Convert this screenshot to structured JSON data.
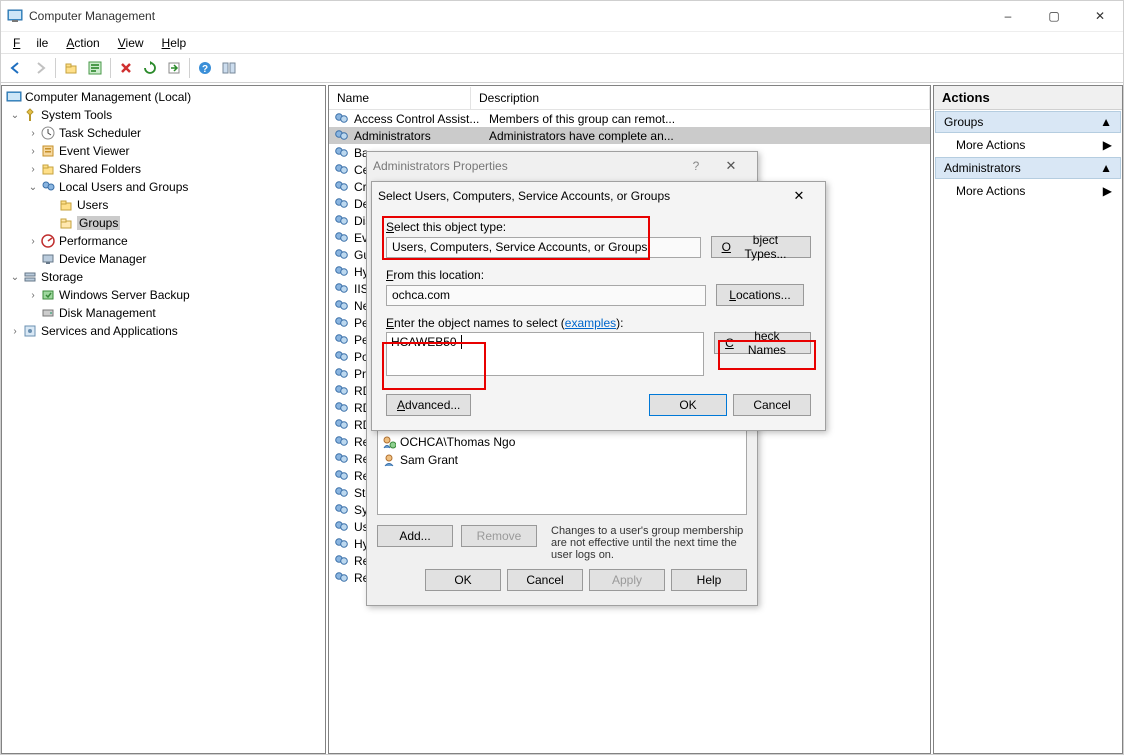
{
  "window": {
    "title": "Computer Management",
    "btn_min": "–",
    "btn_max": "▢",
    "btn_close": "✕"
  },
  "menu": {
    "file": "File",
    "action": "Action",
    "view": "View",
    "help": "Help"
  },
  "tree": {
    "root": "Computer Management (Local)",
    "systools": "System Tools",
    "task": "Task Scheduler",
    "event": "Event Viewer",
    "shared": "Shared Folders",
    "lug": "Local Users and Groups",
    "users": "Users",
    "groups": "Groups",
    "perf": "Performance",
    "devmgr": "Device Manager",
    "storage": "Storage",
    "wsb": "Windows Server Backup",
    "disk": "Disk Management",
    "svc": "Services and Applications"
  },
  "list": {
    "col_name": "Name",
    "col_desc": "Description",
    "rows": [
      {
        "n": "Access Control Assist...",
        "d": "Members of this group can remot..."
      },
      {
        "n": "Administrators",
        "d": "Administrators have complete an...",
        "sel": true
      },
      {
        "n": "Ba",
        "d": ""
      },
      {
        "n": "Ce",
        "d": ""
      },
      {
        "n": "Cr",
        "d": ""
      },
      {
        "n": "De",
        "d": ""
      },
      {
        "n": "Dis",
        "d": ""
      },
      {
        "n": "Ev",
        "d": ""
      },
      {
        "n": "Gu",
        "d": ""
      },
      {
        "n": "Hy",
        "d": ""
      },
      {
        "n": "IIS",
        "d": ""
      },
      {
        "n": "Ne",
        "d": ""
      },
      {
        "n": "Pe",
        "d": ""
      },
      {
        "n": "Pe",
        "d": ""
      },
      {
        "n": "Po",
        "d": ""
      },
      {
        "n": "Pri",
        "d": ""
      },
      {
        "n": "RD",
        "d": ""
      },
      {
        "n": "RD",
        "d": ""
      },
      {
        "n": "RD",
        "d": ""
      },
      {
        "n": "Re",
        "d": ""
      },
      {
        "n": "Re",
        "d": ""
      },
      {
        "n": "Re",
        "d": ""
      },
      {
        "n": "Sto",
        "d": ""
      },
      {
        "n": "Sy",
        "d": ""
      },
      {
        "n": "Us",
        "d": ""
      },
      {
        "n": "Hy",
        "d": ""
      },
      {
        "n": "Remote Control Oper...",
        "d": ""
      },
      {
        "n": "Remote Control View ...",
        "d": ""
      }
    ]
  },
  "actions": {
    "header": "Actions",
    "sec1": "Groups",
    "more1": "More Actions",
    "sec2": "Administrators",
    "more2": "More Actions"
  },
  "prop": {
    "title": "Administrators Properties",
    "members": [
      {
        "n": "OCHCA\\Thomas Ngo",
        "t": "domain"
      },
      {
        "n": "Sam Grant",
        "t": "local"
      }
    ],
    "add": "Add...",
    "remove": "Remove",
    "note": "Changes to a user's group membership are not effective until the next time the user logs on.",
    "ok": "OK",
    "cancel": "Cancel",
    "apply": "Apply",
    "help": "Help"
  },
  "seldlg": {
    "title": "Select Users, Computers, Service Accounts, or Groups",
    "lbl_type": "Select this object type:",
    "val_type": "Users, Computers, Service Accounts, or Groups",
    "btn_type": "Object Types...",
    "lbl_loc": "From this location:",
    "val_loc": "ochca.com",
    "btn_loc": "Locations...",
    "lbl_names": "Enter the object names to select",
    "examples": "examples",
    "val_names": "HCAWEB50",
    "btn_check": "Check Names",
    "btn_adv": "Advanced...",
    "ok": "OK",
    "cancel": "Cancel"
  }
}
